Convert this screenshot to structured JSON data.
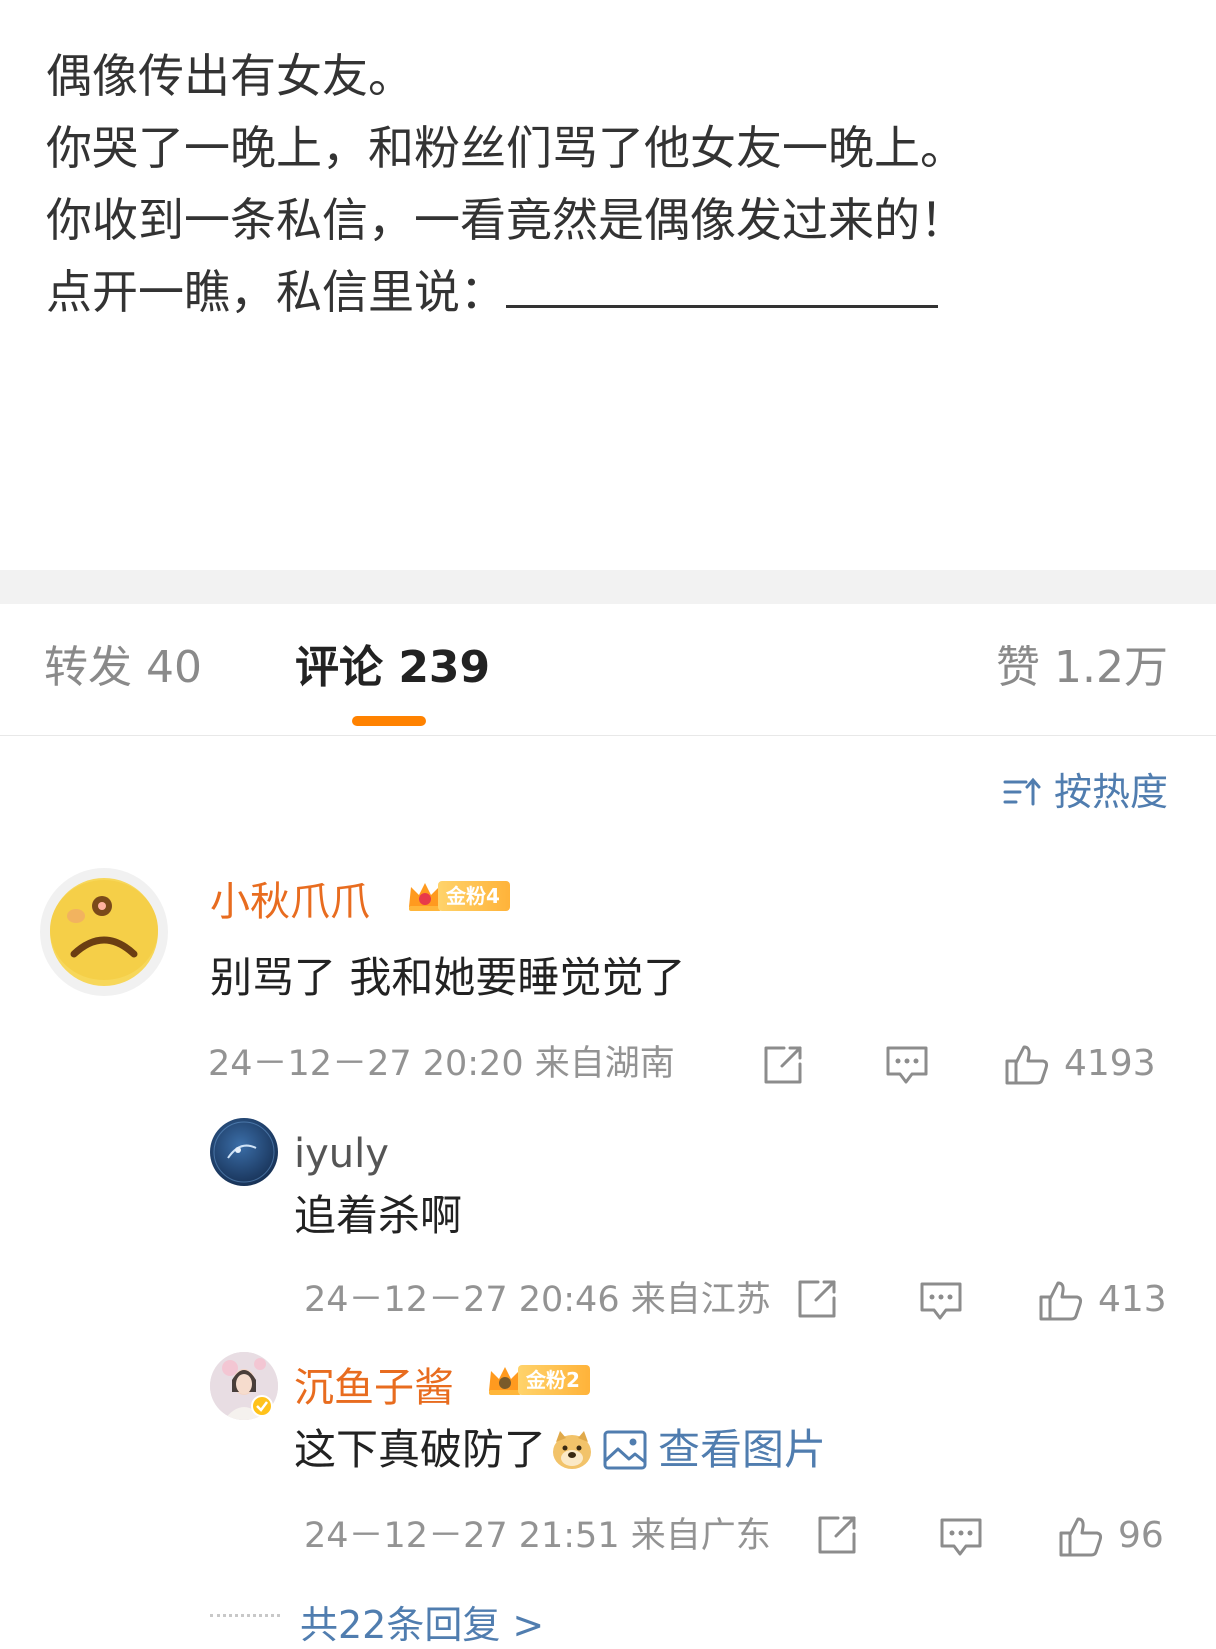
{
  "post": {
    "lines": [
      "偶像传出有女友。",
      "你哭了一晚上，和粉丝们骂了他女友一晚上。",
      "你收到一条私信，一看竟然是偶像发过来的！",
      "点开一瞧，私信里说："
    ]
  },
  "tabs": {
    "repost": "转发 40",
    "comments": "评论 239",
    "likes": "赞 1.2万"
  },
  "sort": {
    "label": "按热度",
    "icon": "sort-icon"
  },
  "comments": [
    {
      "user": "小秋爪爪",
      "badge": "金粉4",
      "text": "别骂了 我和她要睡觉觉了",
      "time": "24－12－27 20:20 来自湖南",
      "likes": "4193"
    }
  ],
  "replies": [
    {
      "user": "iyuly",
      "text": "追着杀啊",
      "time": "24－12－27 20:46 来自江苏",
      "likes": "413"
    },
    {
      "user": "沉鱼子酱",
      "badge": "金粉2",
      "text": "这下真破防了",
      "view_image": "查看图片",
      "time": "24－12－27 21:51 来自广东",
      "likes": "96"
    }
  ],
  "more_replies": "共22条回复 >",
  "colors": {
    "accent": "#ff8200",
    "username": "#e86c1f",
    "link": "#507daf",
    "meta": "#939393"
  }
}
